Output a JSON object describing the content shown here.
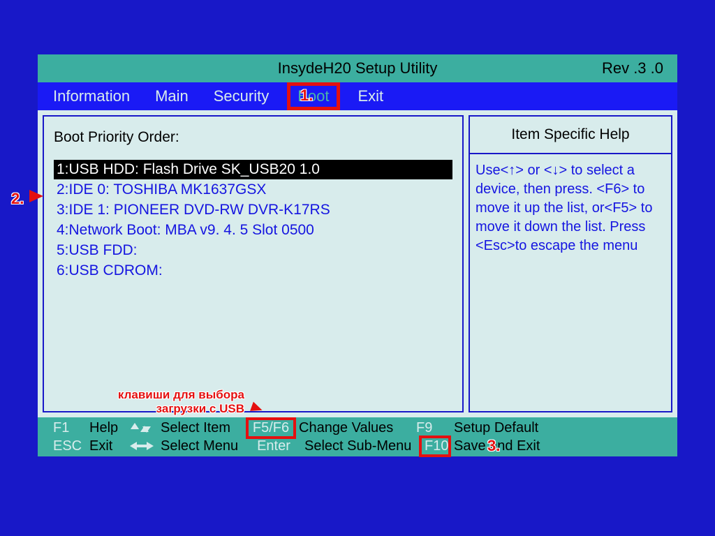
{
  "title_center": "InsydeH20  Setup  Utility",
  "title_right": "Rev .3 .0",
  "menu": [
    {
      "label": "Information",
      "sel": false
    },
    {
      "label": "Main",
      "sel": false
    },
    {
      "label": "Security",
      "sel": false
    },
    {
      "label": "Boot",
      "sel": true
    },
    {
      "label": "Exit",
      "sel": false
    }
  ],
  "section_title": "Boot Priority Order:",
  "boot_items": [
    {
      "label": "1:USB HDD:  Flash Drive  SK_USB20  1.0",
      "sel": true
    },
    {
      "label": "2:IDE 0: TOSHIBA MK1637GSX",
      "sel": false
    },
    {
      "label": "3:IDE 1: PIONEER DVD-RW  DVR-K17RS",
      "sel": false
    },
    {
      "label": "4:Network Boot:  MBA  v9. 4. 5  Slot  0500",
      "sel": false
    },
    {
      "label": "5:USB FDD:",
      "sel": false
    },
    {
      "label": "6:USB CDROM:",
      "sel": false
    }
  ],
  "help_title": "Item Specific Help",
  "help_text": "Use<↑> or <↓> to select a device,  then press. <F6> to move it up the list, or<F5> to move it down the list. Press <Esc>to escape the menu",
  "footer": {
    "r1": {
      "k1": "F1",
      "d1": "Help",
      "k2": "↑ ↓",
      "d2": "Select Item",
      "k3": "F5/F6",
      "d3": "Change Values",
      "k4": "F9",
      "d4": "Setup Default"
    },
    "r2": {
      "k1": "ESC",
      "d1": "Exit",
      "k2": "← →",
      "d2": "Select Menu",
      "k3": "Enter",
      "d3": "Select  Sub-Menu",
      "k4": "F10",
      "d4": "Save and Exit"
    }
  },
  "annot": {
    "n1": "1.",
    "n2": "2.",
    "n3": "3.",
    "label": "клавиши для выбора\nзагрузки с USB"
  }
}
